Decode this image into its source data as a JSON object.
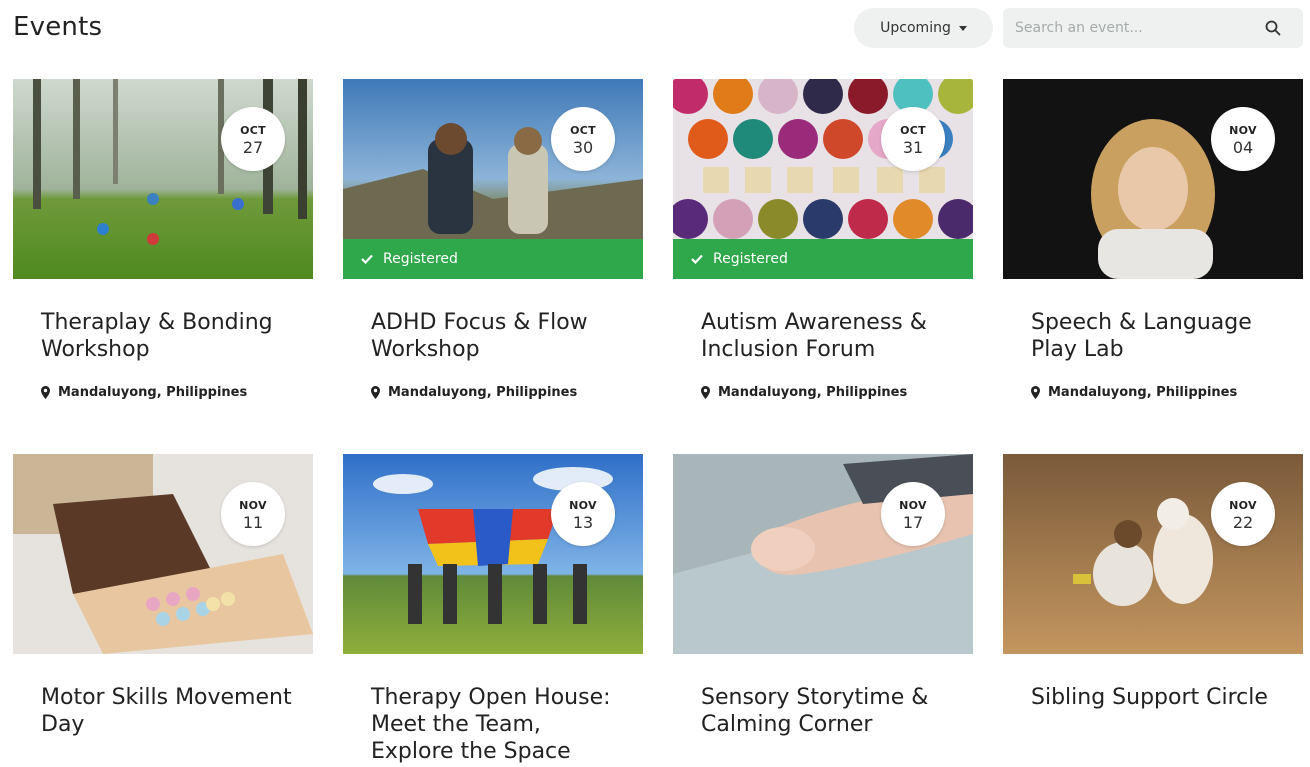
{
  "header": {
    "title": "Events",
    "filter_label": "Upcoming",
    "search_placeholder": "Search an event..."
  },
  "colors": {
    "registered": "#2ea84a",
    "control_bg": "#eef1f0"
  },
  "icons": {
    "filter": "chevron-down-icon",
    "search": "search-icon",
    "location": "map-pin-icon",
    "registered": "check-icon"
  },
  "events": [
    {
      "month": "OCT",
      "day": "27",
      "title": "Theraplay & Bonding Workshop",
      "location": "Mandaluyong, Philippines",
      "registered": false,
      "registered_label": ""
    },
    {
      "month": "OCT",
      "day": "30",
      "title": "ADHD Focus & Flow Workshop",
      "location": "Mandaluyong, Philippines",
      "registered": true,
      "registered_label": "Registered"
    },
    {
      "month": "OCT",
      "day": "31",
      "title": "Autism Awareness & Inclusion Forum",
      "location": "Mandaluyong, Philippines",
      "registered": true,
      "registered_label": "Registered"
    },
    {
      "month": "NOV",
      "day": "04",
      "title": "Speech & Language Play Lab",
      "location": "Mandaluyong, Philippines",
      "registered": false,
      "registered_label": ""
    },
    {
      "month": "NOV",
      "day": "11",
      "title": "Motor Skills Movement Day",
      "location": "",
      "registered": false,
      "registered_label": ""
    },
    {
      "month": "NOV",
      "day": "13",
      "title": "Therapy Open House: Meet the Team, Explore the Space",
      "location": "",
      "registered": false,
      "registered_label": ""
    },
    {
      "month": "NOV",
      "day": "17",
      "title": "Sensory Storytime & Calming Corner",
      "location": "",
      "registered": false,
      "registered_label": ""
    },
    {
      "month": "NOV",
      "day": "22",
      "title": "Sibling Support Circle",
      "location": "",
      "registered": false,
      "registered_label": ""
    }
  ]
}
